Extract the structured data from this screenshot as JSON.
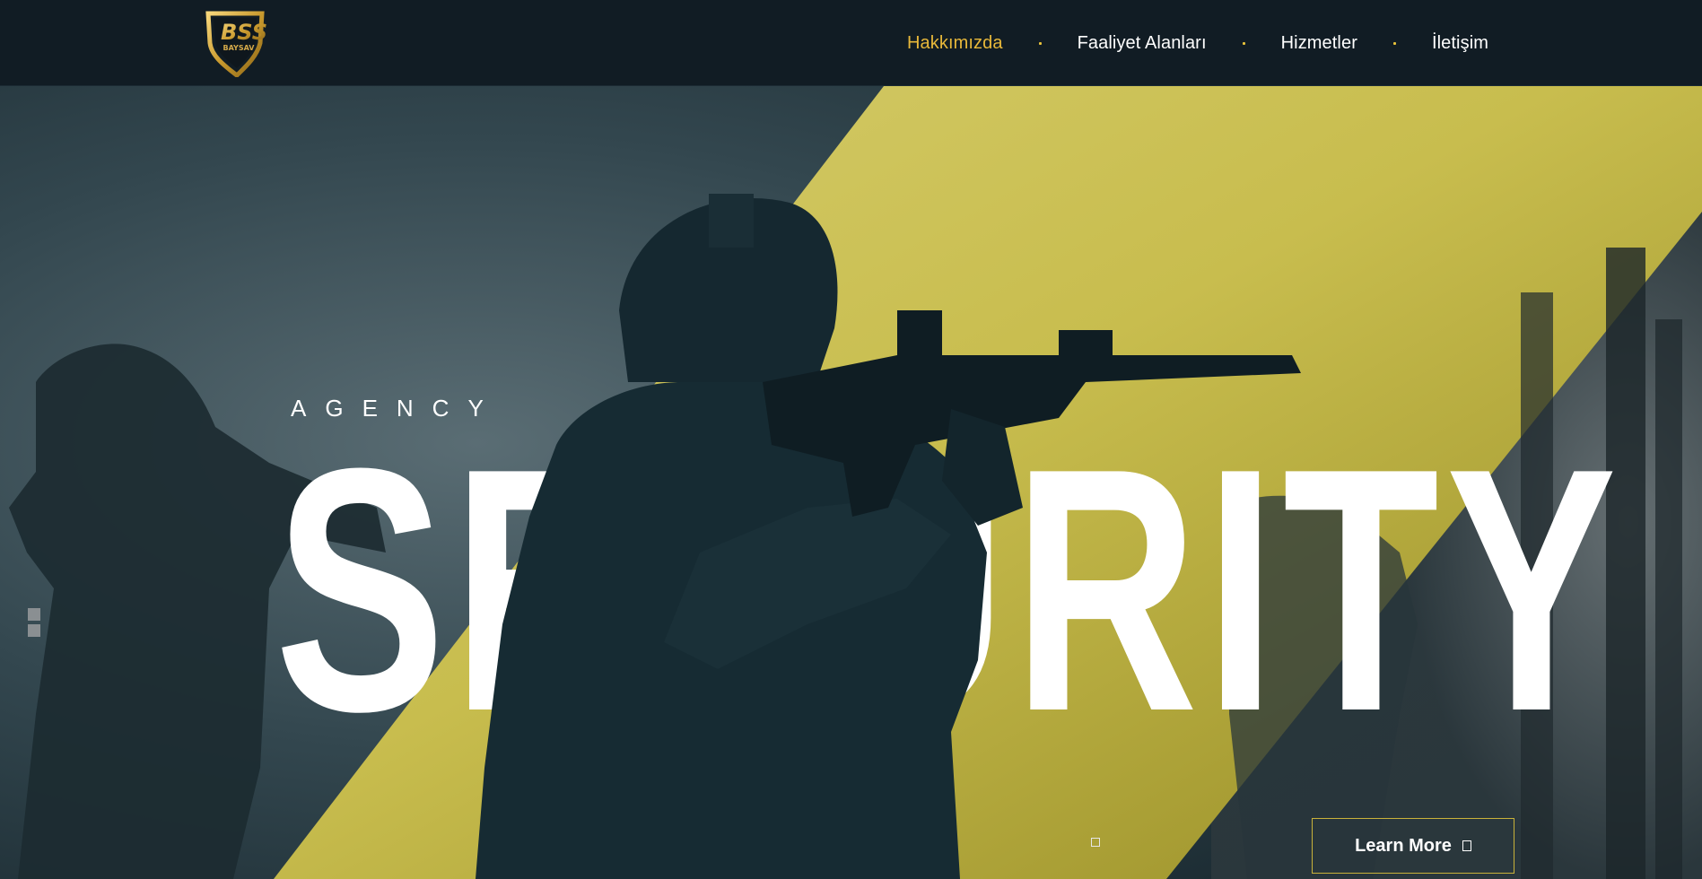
{
  "header": {
    "logo": {
      "text": "BSS",
      "subtext": "BAYSAV",
      "icon": "shield-logo-icon"
    },
    "nav": [
      {
        "label": "Hakkımızda",
        "active": true
      },
      {
        "label": "Faaliyet Alanları",
        "active": false
      },
      {
        "label": "Hizmetler",
        "active": false
      },
      {
        "label": "İletişim",
        "active": false
      }
    ]
  },
  "hero": {
    "kicker": "AGENCY",
    "headline": "SECURITY",
    "cta": {
      "label": "Learn More",
      "icon": "square-arrow-icon"
    },
    "side_dots_icon": "slider-dots-icon",
    "slide_indicator_icon": "slide-indicator-icon"
  },
  "colors": {
    "header_bg": "#111c24",
    "accent_gold": "#e8b83a",
    "stripe_yellow": "#c8bd4e",
    "text_white": "#ffffff"
  }
}
